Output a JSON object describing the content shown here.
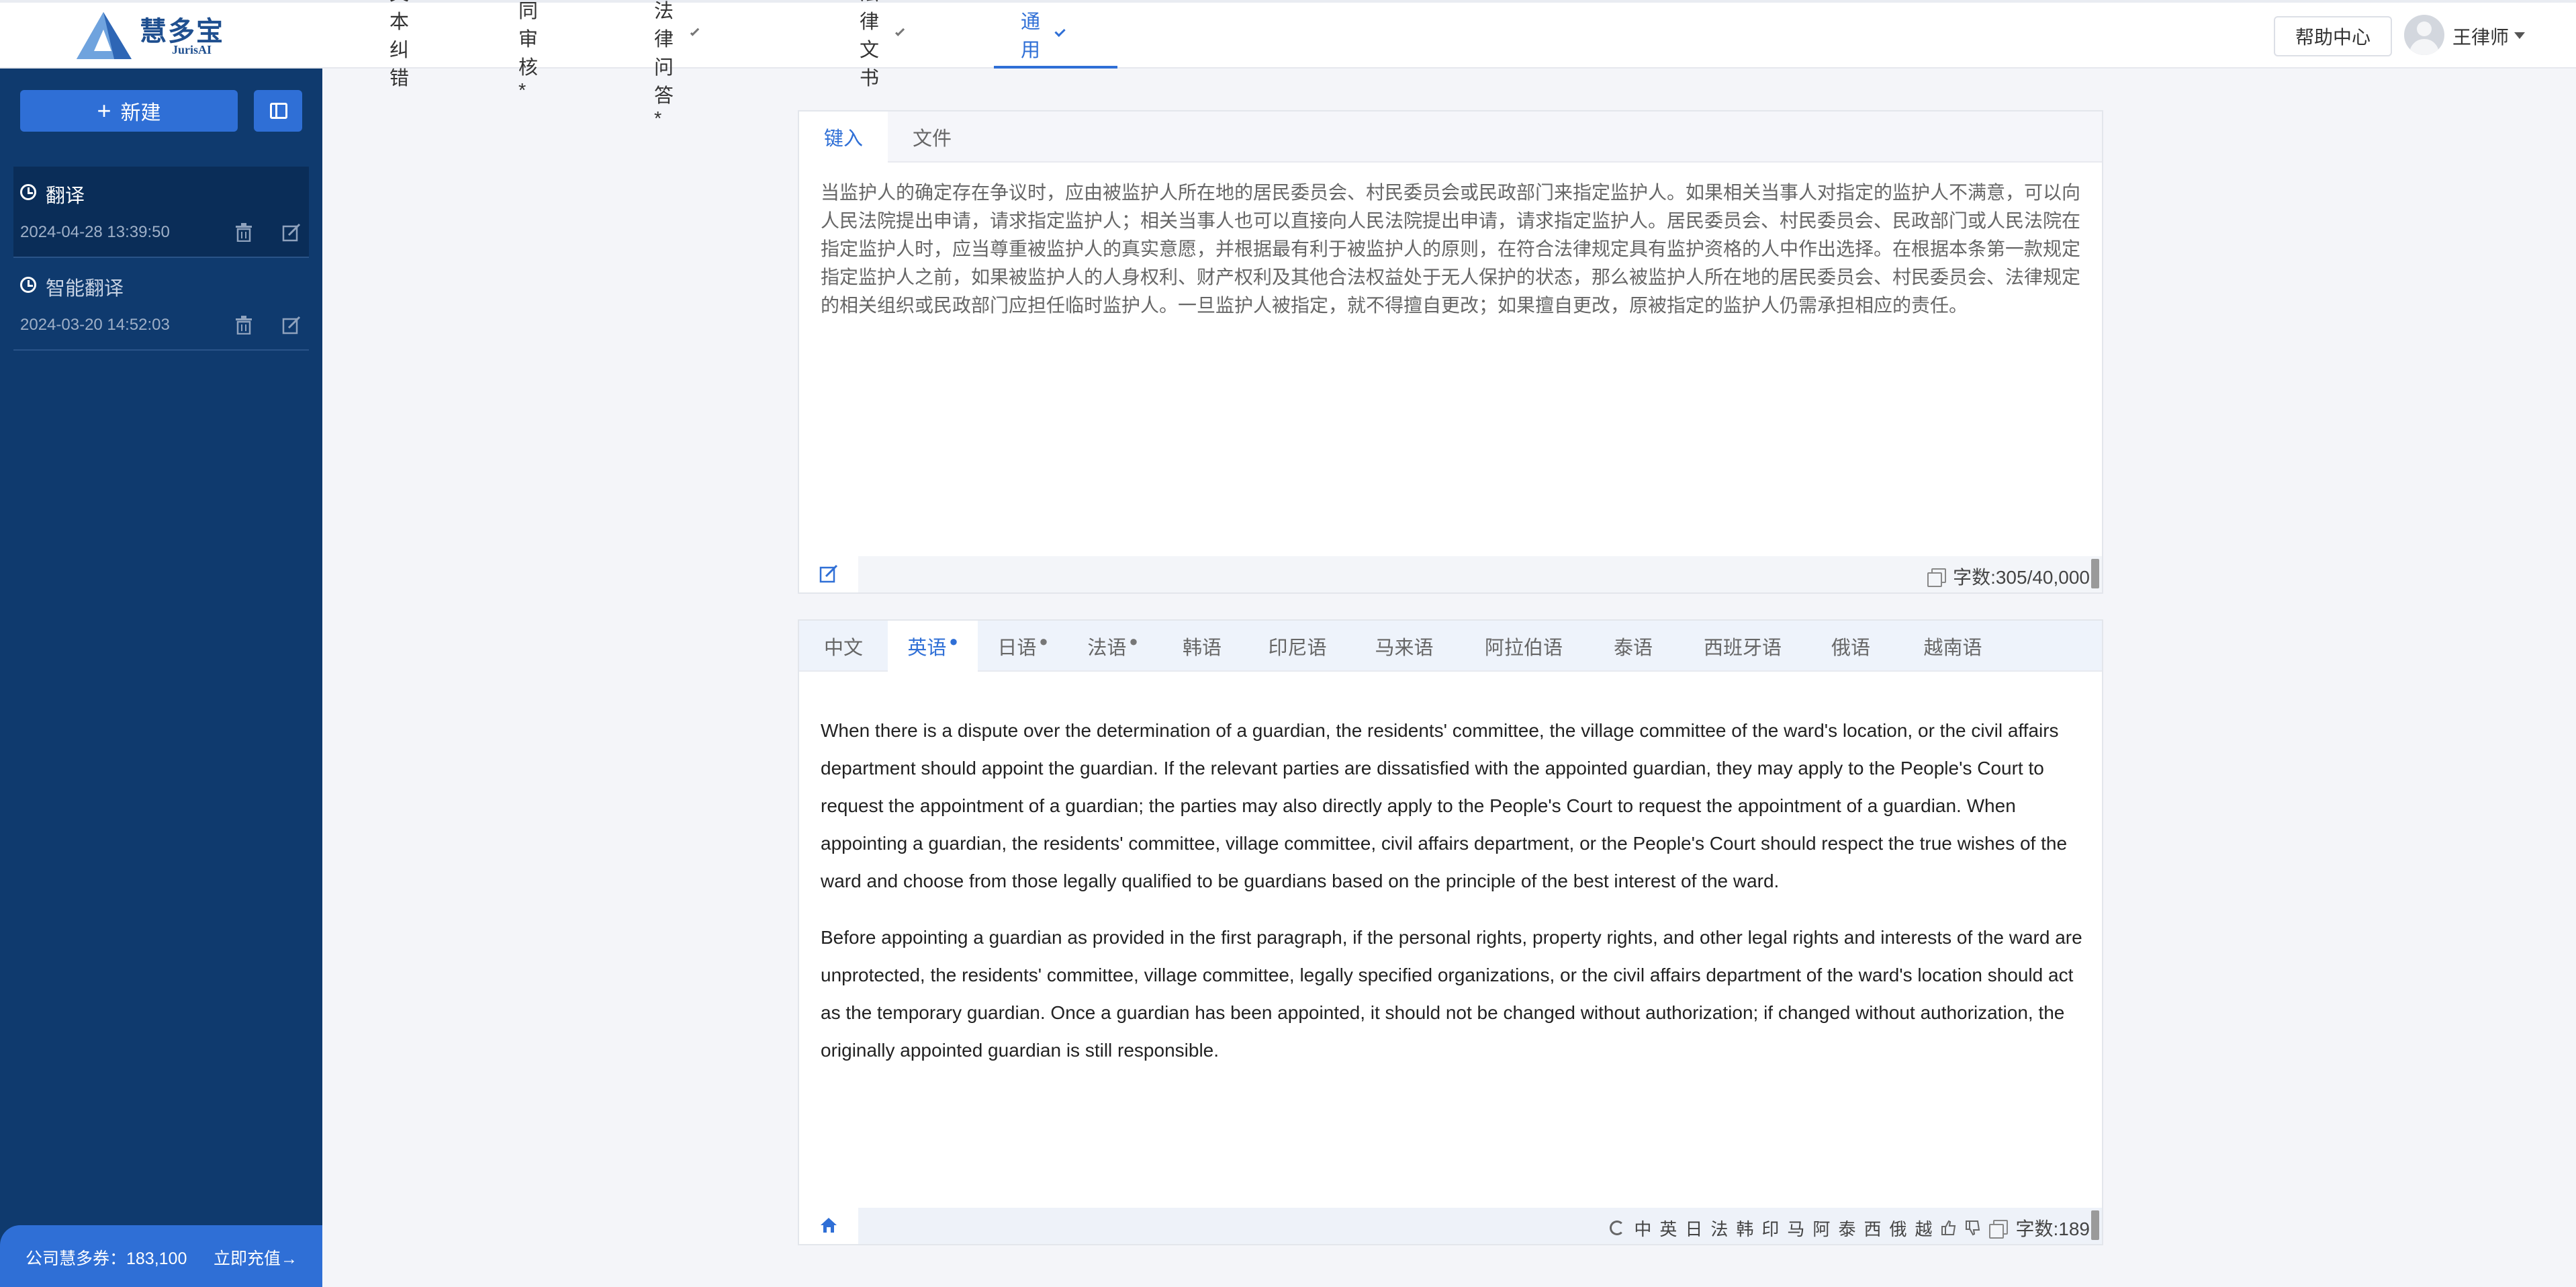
{
  "brand": {
    "name": "慧多宝",
    "name_en": "JurisAI"
  },
  "nav": [
    {
      "label": "文本纠错",
      "dropdown": false,
      "active": false
    },
    {
      "label": "合同审核*",
      "dropdown": false,
      "active": false
    },
    {
      "label": "中国法律问答*",
      "dropdown": true,
      "active": false
    },
    {
      "label": "法律文书",
      "dropdown": true,
      "active": false
    },
    {
      "label": "通用",
      "dropdown": true,
      "active": true
    }
  ],
  "header": {
    "help_label": "帮助中心",
    "username": "王律师"
  },
  "sidebar": {
    "new_label": "新建",
    "history": [
      {
        "title": "翻译",
        "date": "2024-04-28 13:39:50",
        "selected": true
      },
      {
        "title": "智能翻译",
        "date": "2024-03-20 14:52:03",
        "selected": false
      }
    ],
    "credit_label": "公司慧多券：183,100",
    "recharge_label": "立即充值→"
  },
  "input_panel": {
    "tabs": [
      {
        "label": "键入",
        "active": true
      },
      {
        "label": "文件",
        "active": false
      }
    ],
    "text": "当监护人的确定存在争议时，应由被监护人所在地的居民委员会、村民委员会或民政部门来指定监护人。如果相关当事人对指定的监护人不满意，可以向人民法院提出申请，请求指定监护人；相关当事人也可以直接向人民法院提出申请，请求指定监护人。居民委员会、村民委员会、民政部门或人民法院在指定监护人时，应当尊重被监护人的真实意愿，并根据最有利于被监护人的原则，在符合法律规定具有监护资格的人中作出选择。在根据本条第一款规定指定监护人之前，如果被监护人的人身权利、财产权利及其他合法权益处于无人保护的状态，那么被监护人所在地的居民委员会、村民委员会、法律规定的相关组织或民政部门应担任临时监护人。一旦监护人被指定，就不得擅自更改；如果擅自更改，原被指定的监护人仍需承担相应的责任。",
    "char_count": "字数:305/40,000"
  },
  "output_panel": {
    "tabs": [
      {
        "label": "中文",
        "active": false,
        "dot": false
      },
      {
        "label": "英语",
        "active": true,
        "dot": true
      },
      {
        "label": "日语",
        "active": false,
        "dot": true
      },
      {
        "label": "法语",
        "active": false,
        "dot": true
      },
      {
        "label": "韩语",
        "active": false,
        "dot": false
      },
      {
        "label": "印尼语",
        "active": false,
        "dot": false
      },
      {
        "label": "马来语",
        "active": false,
        "dot": false
      },
      {
        "label": "阿拉伯语",
        "active": false,
        "dot": false
      },
      {
        "label": "泰语",
        "active": false,
        "dot": false
      },
      {
        "label": "西班牙语",
        "active": false,
        "dot": false
      },
      {
        "label": "俄语",
        "active": false,
        "dot": false
      },
      {
        "label": "越南语",
        "active": false,
        "dot": false
      }
    ],
    "paragraphs": [
      "When there is a dispute over the determination of a guardian, the residents' committee, the village committee of the ward's location, or the civil affairs department should appoint the guardian. If the relevant parties are dissatisfied with the appointed guardian, they may apply to the People's Court to request the appointment of a guardian; the parties may also directly apply to the People's Court to request the appointment of a guardian. When appointing a guardian, the residents' committee, village committee, civil affairs department, or the People's Court should respect the true wishes of the ward and choose from those legally qualified to be guardians based on the principle of the best interest of the ward.",
      "Before appointing a guardian as provided in the first paragraph, if the personal rights, property rights, and other legal rights and interests of the ward are unprotected, the residents' committee, village committee, legally specified organizations, or the civil affairs department of the ward's location should act as the temporary guardian. Once a guardian has been appointed, it should not be changed without authorization; if changed without authorization, the originally appointed guardian is still responsible."
    ],
    "quick_langs": [
      "中",
      "英",
      "日",
      "法",
      "韩",
      "印",
      "马",
      "阿",
      "泰",
      "西",
      "俄",
      "越"
    ],
    "char_count": "字数:189"
  },
  "colors": {
    "accent": "#2f6fd6",
    "sidebar": "#0f3a6e"
  }
}
